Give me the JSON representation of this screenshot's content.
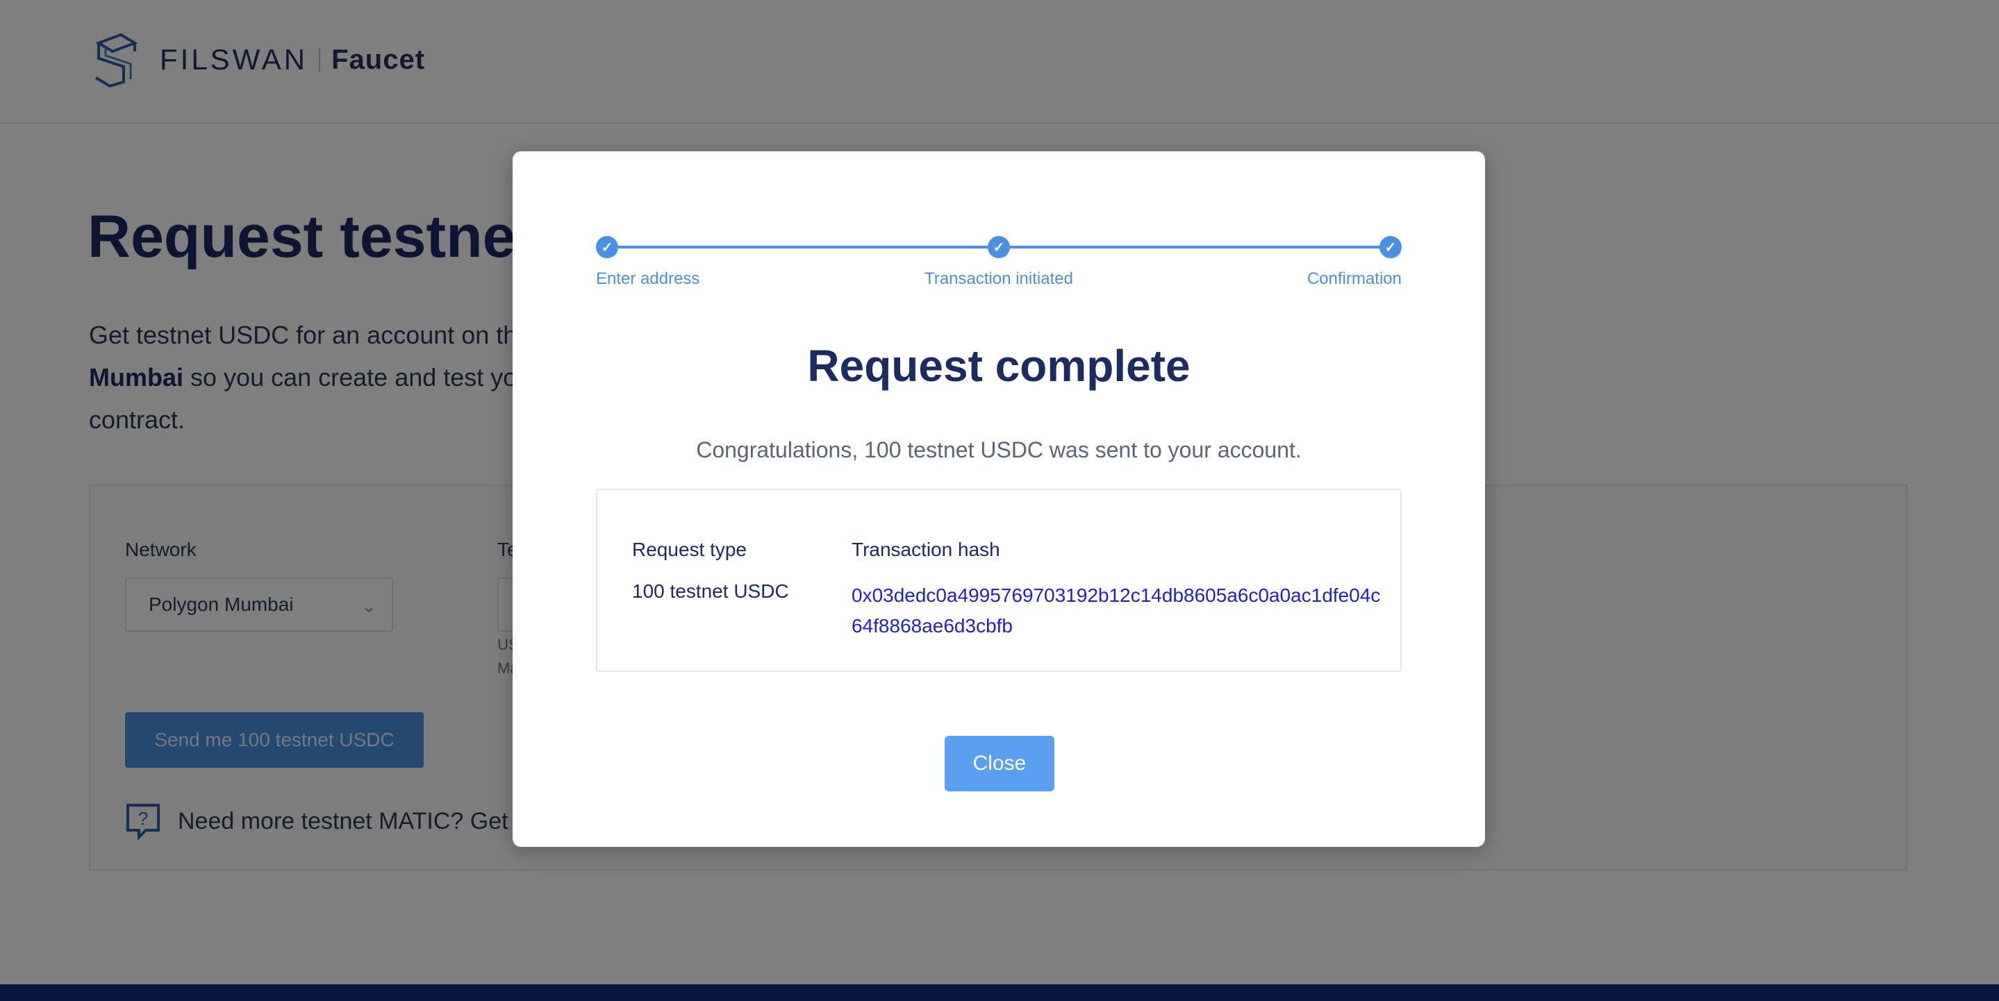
{
  "header": {
    "brand": "FILSWAN",
    "product": "Faucet"
  },
  "hero": {
    "title": "Request testnet U",
    "desc_prefix": "Get testnet USDC for an account on th",
    "desc_bold": "Mumbai",
    "desc_mid": " so you can create and test yo",
    "desc_end": "contract."
  },
  "form": {
    "network_label": "Network",
    "network_value": "Polygon Mumbai",
    "address_label": "Te",
    "hint_line1": "US",
    "hint_line2": "Ma",
    "send_button": "Send me 100 testnet USDC",
    "matic_text": "Need more testnet MATIC? Get M"
  },
  "modal": {
    "steps": [
      {
        "label": "Enter address",
        "done": true
      },
      {
        "label": "Transaction initiated",
        "done": true
      },
      {
        "label": "Confirmation",
        "done": true
      }
    ],
    "title": "Request complete",
    "subtitle": "Congratulations, 100 testnet USDC was sent to your account.",
    "result": {
      "type_header": "Request type",
      "hash_header": "Transaction hash",
      "type_value": "100 testnet USDC",
      "hash_value": "0x03dedc0a4995769703192b12c14db8605a6c0a0ac1dfe04c64f8868ae6d3cbfb"
    },
    "close_button": "Close"
  },
  "colors": {
    "accent": "#4a90e2",
    "title": "#1d2b64",
    "link": "#1f1fd6",
    "overlay": "rgba(0,0,0,0.5)"
  }
}
